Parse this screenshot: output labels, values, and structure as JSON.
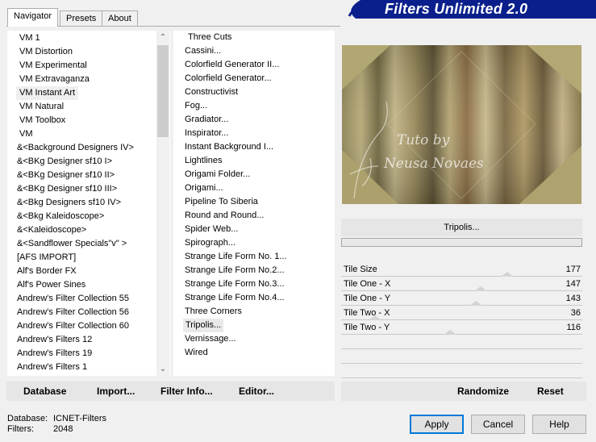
{
  "tabs": [
    {
      "label": "Navigator"
    },
    {
      "label": "Presets"
    },
    {
      "label": "About"
    }
  ],
  "banner": {
    "title": "Filters Unlimited 2.0"
  },
  "categories": [
    "VM 1",
    "VM Distortion",
    "VM Experimental",
    "VM Extravaganza",
    "VM Instant Art",
    "VM Natural",
    "VM Toolbox",
    "VM",
    "&<Background Designers IV>",
    "&<BKg Designer sf10 I>",
    "&<BKg Designer sf10 II>",
    "&<BKg Designer sf10 III>",
    "&<Bkg Designers sf10 IV>",
    "&<Bkg Kaleidoscope>",
    "&<Kaleidoscope>",
    "&<Sandflower Specials\"v\" >",
    "[AFS IMPORT]",
    "Alf's Border FX",
    "Alf's Power Sines",
    "Andrew's Filter Collection 55",
    "Andrew's Filter Collection 56",
    "Andrew's Filter Collection 60",
    "Andrew's Filters 12",
    "Andrew's Filters 19",
    "Andrew's Filters 1"
  ],
  "selected_category": "VM Instant Art",
  "filters": [
    "Three Cuts",
    "Cassini...",
    "Colorfield Generator II...",
    "Colorfield Generator...",
    "Constructivist",
    "Fog...",
    "Gradiator...",
    "Inspirator...",
    "Instant Background I...",
    "Lightlines",
    "Origami Folder...",
    "Origami...",
    "Pipeline To Siberia",
    "Round and Round...",
    "Spider Web...",
    "Spirograph...",
    "Strange Life Form No. 1...",
    "Strange Life Form No.2...",
    "Strange Life Form No.3...",
    "Strange Life Form No.4...",
    "Three Corners",
    "Tripolis...",
    "Vernissage...",
    "Wired"
  ],
  "selected_filter": "Tripolis...",
  "watermark": {
    "line1": "Tuto by",
    "line2": "Neusa Novaes"
  },
  "current_filter": "Tripolis...",
  "params": [
    {
      "label": "Tile Size",
      "value": "177",
      "fraction": 0.69
    },
    {
      "label": "Tile One - X",
      "value": "147",
      "fraction": 0.58
    },
    {
      "label": "Tile One - Y",
      "value": "143",
      "fraction": 0.56
    },
    {
      "label": "Tile Two - X",
      "value": "36",
      "fraction": 0.14
    },
    {
      "label": "Tile Two - Y",
      "value": "116",
      "fraction": 0.45
    }
  ],
  "toolbar": {
    "database": "Database",
    "import": "Import...",
    "filter_info": "Filter Info...",
    "editor": "Editor...",
    "randomize": "Randomize",
    "reset": "Reset"
  },
  "status": {
    "database_label": "Database:",
    "database_value": "ICNET-Filters",
    "filters_label": "Filters:",
    "filters_value": "2048"
  },
  "buttons": {
    "apply": "Apply",
    "cancel": "Cancel",
    "help": "Help"
  },
  "colors": {
    "banner_bg": "#0a1f8c",
    "accent": "#0078d7"
  }
}
